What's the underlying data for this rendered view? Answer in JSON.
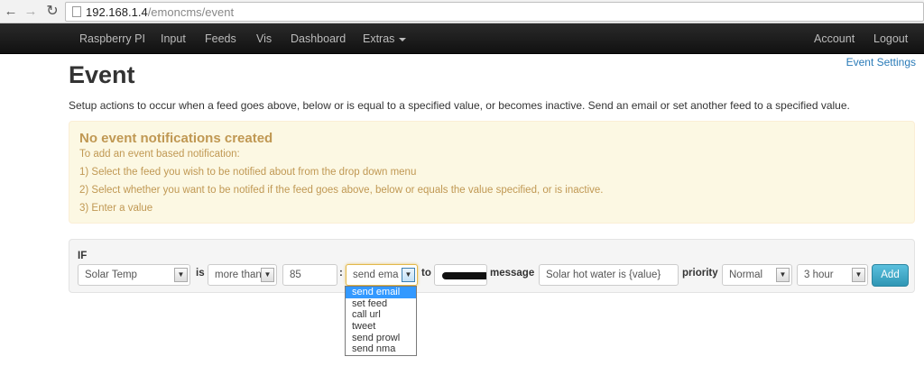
{
  "browser": {
    "url_host": "192.168.1.4",
    "url_path": "/emoncms/event"
  },
  "navbar": {
    "left": [
      "Raspberry PI",
      "Input",
      "Feeds",
      "Vis",
      "Dashboard",
      "Extras"
    ],
    "right": [
      "Account",
      "Logout"
    ]
  },
  "page": {
    "title": "Event",
    "settings_link": "Event Settings",
    "description": "Setup actions to occur when a feed goes above, below or is equal to a specified value, or becomes inactive. Send an email or set another feed to a specified value."
  },
  "alert": {
    "title": "No event notifications created",
    "lines": [
      "To add an event based notification:",
      "1) Select the feed you wish to be notified about from the drop down menu",
      "2) Select whether you want to be notifed if the feed goes above, below or equals the value specified, or is inactive.",
      "3) Enter a value"
    ]
  },
  "form": {
    "if_label": "IF",
    "feed": "Solar Temp",
    "is_label": "is",
    "condition": "more than",
    "value": "85",
    "colon": ":",
    "action": "send ema",
    "to_label": "to",
    "message_label": "message",
    "message": "Solar hot water is {value}",
    "priority_label": "priority",
    "priority": "Normal",
    "interval": "3 hour",
    "add_label": "Add"
  },
  "action_options": [
    "send email",
    "set feed",
    "call url",
    "tweet",
    "send prowl",
    "send nma"
  ],
  "colors": {
    "navbar": "#1b1b1b",
    "alert_bg": "#fcf8e3",
    "alert_text": "#c09853",
    "link": "#2a7bb8",
    "button": "#49afcd",
    "selected_option": "#3399ff"
  }
}
